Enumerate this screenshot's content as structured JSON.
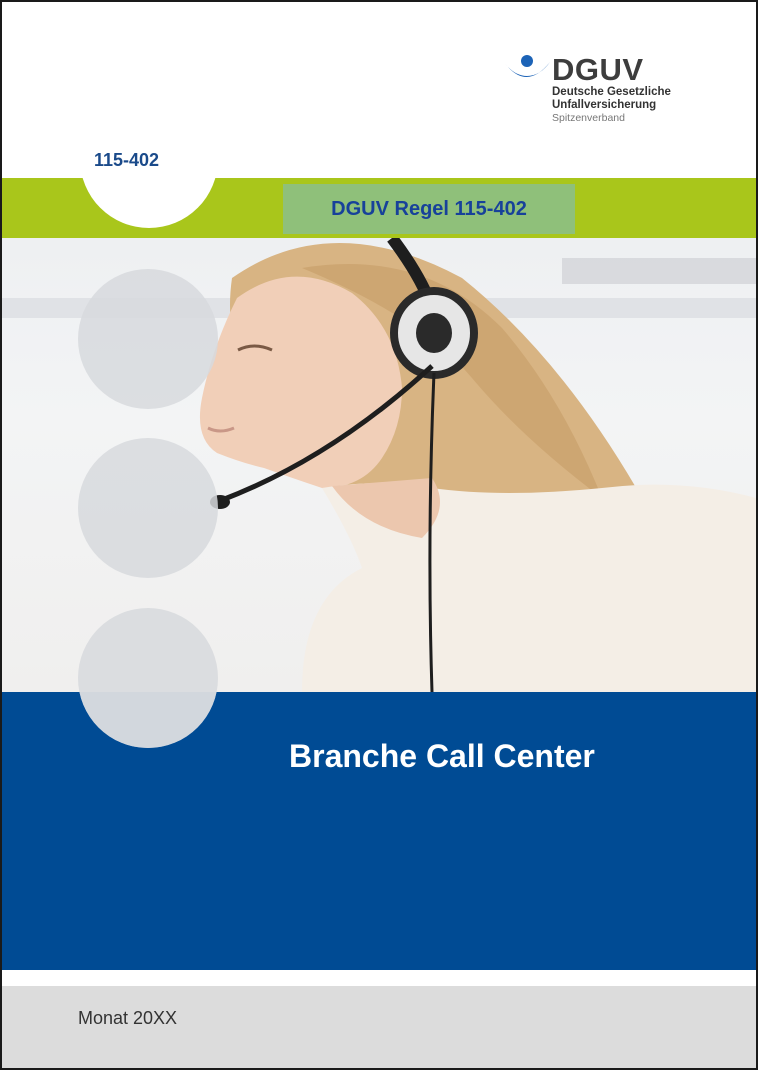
{
  "header": {
    "logo": {
      "abbreviation": "DGUV",
      "line1": "Deutsche Gesetzliche",
      "line2": "Unfallversicherung",
      "line3": "Spitzenverband"
    },
    "document_number": "115-402",
    "rule_title": "DGUV Regel 115-402"
  },
  "main": {
    "sector_title": "Branche Call Center"
  },
  "footer": {
    "date": "Monat 20XX"
  },
  "colors": {
    "green_band": "#a9c61b",
    "rule_box": "#8fc07a",
    "title_blue": "#17419a",
    "cover_blue": "#004b94",
    "footer_gray": "#dcdcdc"
  },
  "icons": [
    "dguv-logo-icon"
  ]
}
